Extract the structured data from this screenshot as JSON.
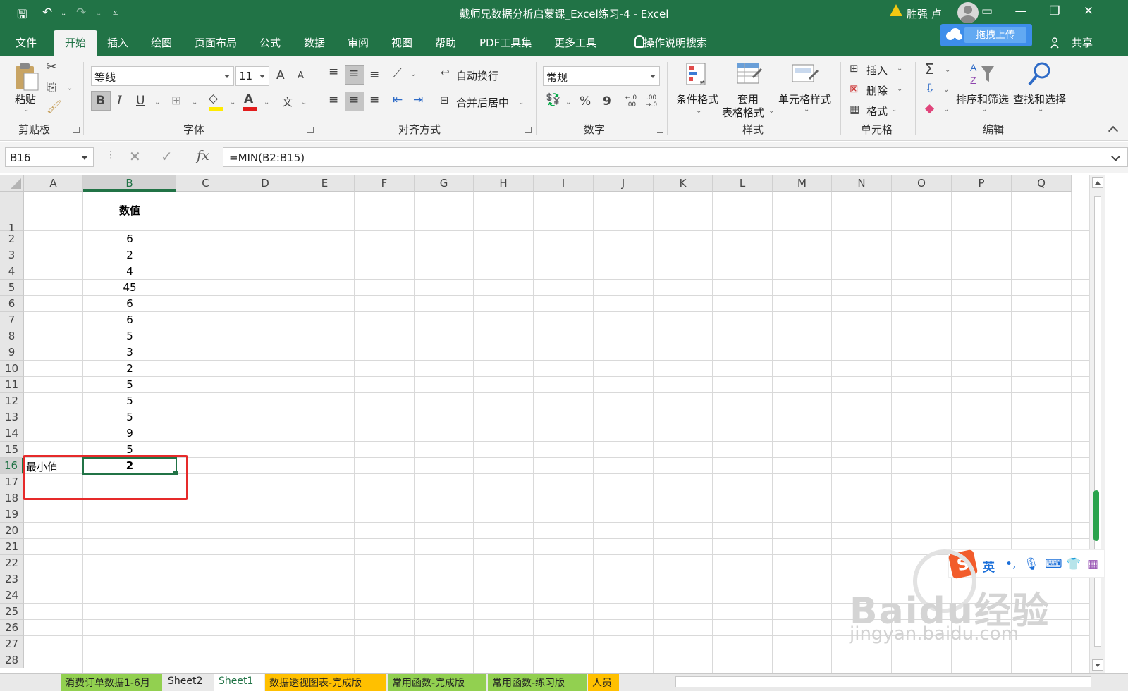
{
  "titlebar": {
    "title": "戴师兄数据分析启蒙课_Excel练习-4  -  Excel",
    "user": "胜强 卢",
    "quick_access": {
      "save": "🖫",
      "undo": "↶",
      "redo": "↷",
      "customize": "⩡"
    },
    "controls": {
      "ribbon_display": "▭",
      "minimize": "—",
      "restore": "❐",
      "close": "✕"
    }
  },
  "menu": {
    "tabs": [
      "文件",
      "开始",
      "插入",
      "绘图",
      "页面布局",
      "公式",
      "数据",
      "审阅",
      "视图",
      "帮助",
      "PDF工具集",
      "更多工具"
    ],
    "active_tab": "开始",
    "tell_me": "操作说明搜索",
    "upload": "拖拽上传",
    "share": "共享"
  },
  "ribbon": {
    "clipboard": {
      "paste": "粘贴",
      "group": "剪贴板"
    },
    "font": {
      "name": "等线",
      "size": "11",
      "group": "字体",
      "bold": "B",
      "italic": "I",
      "underline": "U",
      "grow": "A",
      "shrink": "A",
      "font_color": "A",
      "phonetic": "文"
    },
    "alignment": {
      "wrap": "自动换行",
      "merge": "合并后居中",
      "group": "对齐方式"
    },
    "number": {
      "format": "常规",
      "percent": "%",
      "comma": "9",
      "inc": "←.0 .00",
      "dec": ".00 →.0",
      "group": "数字"
    },
    "styles": {
      "conditional": "条件格式",
      "table_line1": "套用",
      "table_line2": "表格格式",
      "cell_styles": "单元格样式",
      "group": "样式"
    },
    "cells": {
      "insert": "插入",
      "delete": "删除",
      "format": "格式",
      "group": "单元格"
    },
    "editing": {
      "sum": "Σ",
      "sort_filter": "排序和筛选",
      "find_select": "查找和选择",
      "group": "编辑"
    }
  },
  "formula_bar": {
    "name_box": "B16",
    "cancel": "✕",
    "enter": "✓",
    "fx": "fx",
    "formula": "=MIN(B2:B15)"
  },
  "columns": [
    "A",
    "B",
    "C",
    "D",
    "E",
    "F",
    "G",
    "H",
    "I",
    "J",
    "K",
    "L",
    "M",
    "N",
    "O",
    "P",
    "Q"
  ],
  "selected_column": "B",
  "rows": [
    "1",
    "2",
    "3",
    "4",
    "5",
    "6",
    "7",
    "8",
    "9",
    "10",
    "11",
    "12",
    "13",
    "14",
    "15",
    "16",
    "17",
    "18",
    "19",
    "20",
    "21",
    "22",
    "23",
    "24",
    "25",
    "26",
    "27",
    "28"
  ],
  "selected_row": "16",
  "cells": {
    "B1": "数值",
    "B2": "6",
    "B3": "2",
    "B4": "4",
    "B5": "45",
    "B6": "6",
    "B7": "6",
    "B8": "5",
    "B9": "3",
    "B10": "2",
    "B11": "5",
    "B12": "5",
    "B13": "5",
    "B14": "9",
    "B15": "5",
    "A16": "最小值",
    "B16": "2"
  },
  "ime": {
    "logo": "S",
    "lang": "英",
    "punct": "•,",
    "mic": "🎙",
    "keyboard": "⌨",
    "skin": "👕",
    "apps": "▦"
  },
  "watermark": {
    "brand": "Baidu经验",
    "url": "jingyan.baidu.com"
  },
  "sheet_tabs": [
    "消费订单数据1-6月",
    "Sheet2",
    "Sheet1",
    "数据透视图表-完成版",
    "常用函数-完成版",
    "常用函数-练习版",
    "人员"
  ],
  "colors": {
    "accent": "#217346",
    "highlight_box": "#e62a2a",
    "upload": "#3d8dea"
  }
}
